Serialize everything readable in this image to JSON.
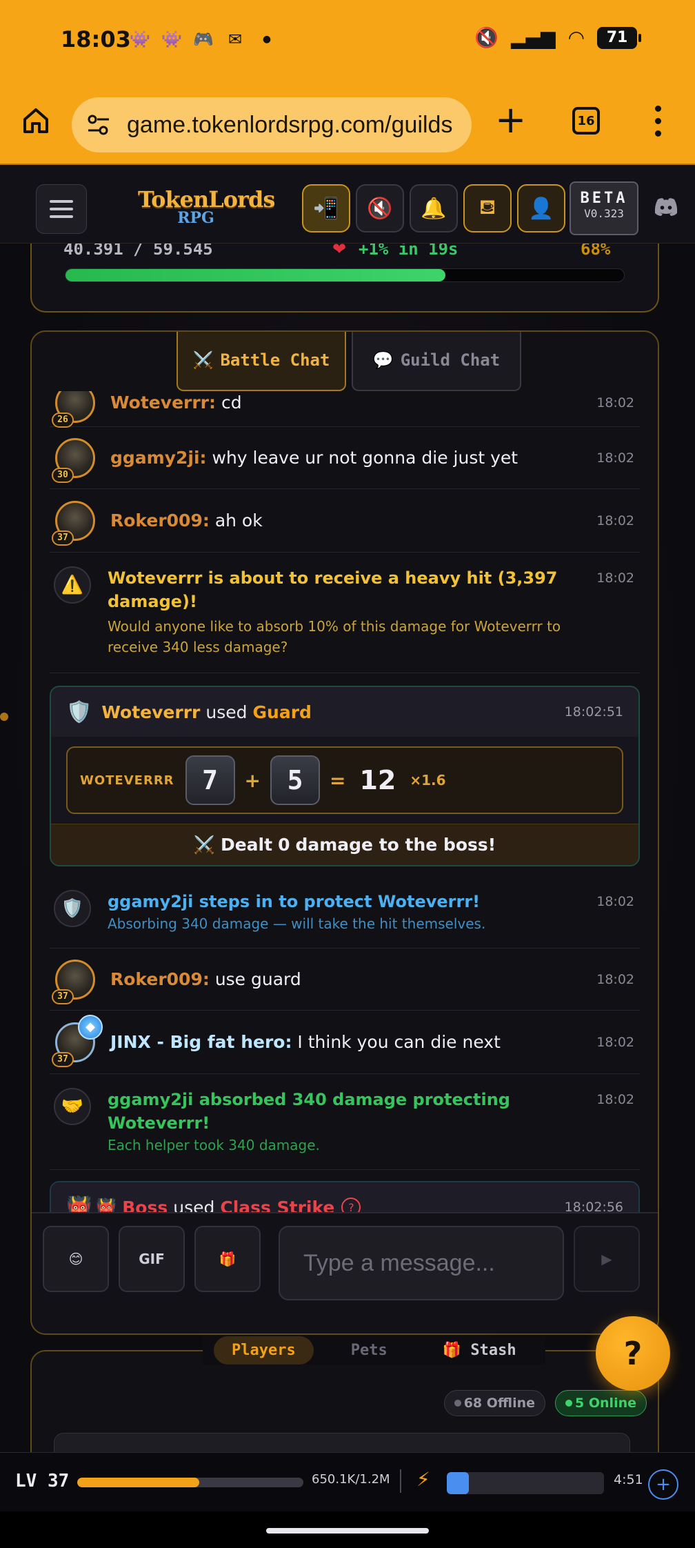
{
  "status_bar": {
    "time": "18:03",
    "notification_icons": [
      "discord-icon",
      "discord-icon",
      "game-controller-icon",
      "gmail-icon",
      "dot-icon"
    ],
    "battery": "71"
  },
  "browser": {
    "url": "game.tokenlordsrpg.com/guilds",
    "tab_count": "16"
  },
  "header": {
    "logo_line1": "TokenLords",
    "logo_line2": "RPG",
    "beta_label": "BETA",
    "version": "V0.323"
  },
  "hp": {
    "value": "40.391 / 59.545",
    "regen": "+1% in 19s",
    "percent_text": "68%",
    "fill_fraction": 0.68
  },
  "chat": {
    "tabs": [
      {
        "icon": "⚔️",
        "label": "Battle Chat"
      },
      {
        "icon": "💬",
        "label": "Guild Chat"
      }
    ],
    "messages": [
      {
        "user": "Woteverrr:",
        "text": "cd",
        "time": "18:02",
        "level": "26"
      },
      {
        "user": "ggamy2ji:",
        "text": "why leave ur not gonna die just yet",
        "time": "18:02",
        "level": "30"
      },
      {
        "user": "Roker009:",
        "text": "ah ok",
        "time": "18:02",
        "level": "37"
      }
    ],
    "system_warning": {
      "title": "Woteverrr is about to receive a heavy hit (3,397 damage)!",
      "body": "Would anyone like to absorb 10% of this damage for Woteverrr to receive 340 less damage?",
      "time": "18:02"
    },
    "guard_action": {
      "actor": "Woteverrr",
      "verb": "used",
      "skill": "Guard",
      "time": "18:02:51",
      "roll_name": "WOTEVERRR",
      "die1": "7",
      "plus": "+",
      "die2": "5",
      "equals": "=",
      "total": "12",
      "multiplier": "×1.6",
      "dealt_prefix": "Dealt",
      "dealt_value": "0",
      "dealt_suffix": "damage to the boss!"
    },
    "protect_notice": {
      "title": "ggamy2ji steps in to protect Woteverrr!",
      "body": "Absorbing 340 damage — will take the hit themselves.",
      "time": "18:02"
    },
    "messages2": [
      {
        "user": "Roker009:",
        "text": "use guard",
        "time": "18:02",
        "level": "37"
      },
      {
        "user": "JINX - Big fat hero:",
        "text": "I think you can die next",
        "time": "18:02",
        "level": "37"
      }
    ],
    "absorb_notice": {
      "title": "ggamy2ji absorbed 340 damage protecting Woteverrr!",
      "body": "Each helper took 340 damage.",
      "time": "18:02"
    },
    "boss_action": {
      "actor": "Boss",
      "verb": "used",
      "skill": "Class Strike",
      "time": "18:02:56"
    },
    "input": {
      "emoji_button": "😊",
      "gif_button": "GIF",
      "gift_button": "🎁",
      "placeholder": "Type a message...",
      "send_button": "▶"
    }
  },
  "players": {
    "tabs": [
      "Players",
      "Pets",
      "Stash"
    ],
    "offline": "68 Offline",
    "online": "5 Online"
  },
  "help_button": "?",
  "xp": {
    "level": "LV 37",
    "xp_text": "650.1K/1.2M",
    "xp_fraction": 0.54,
    "energy_fraction": 0.14,
    "timer": "4:51"
  },
  "colors": {
    "accent": "#f6a516",
    "gold": "#f2b43c",
    "online_green": "#3ed36b",
    "warning_yellow": "#f2c233",
    "info_blue": "#4db0f0",
    "boss_red": "#e8444a"
  }
}
